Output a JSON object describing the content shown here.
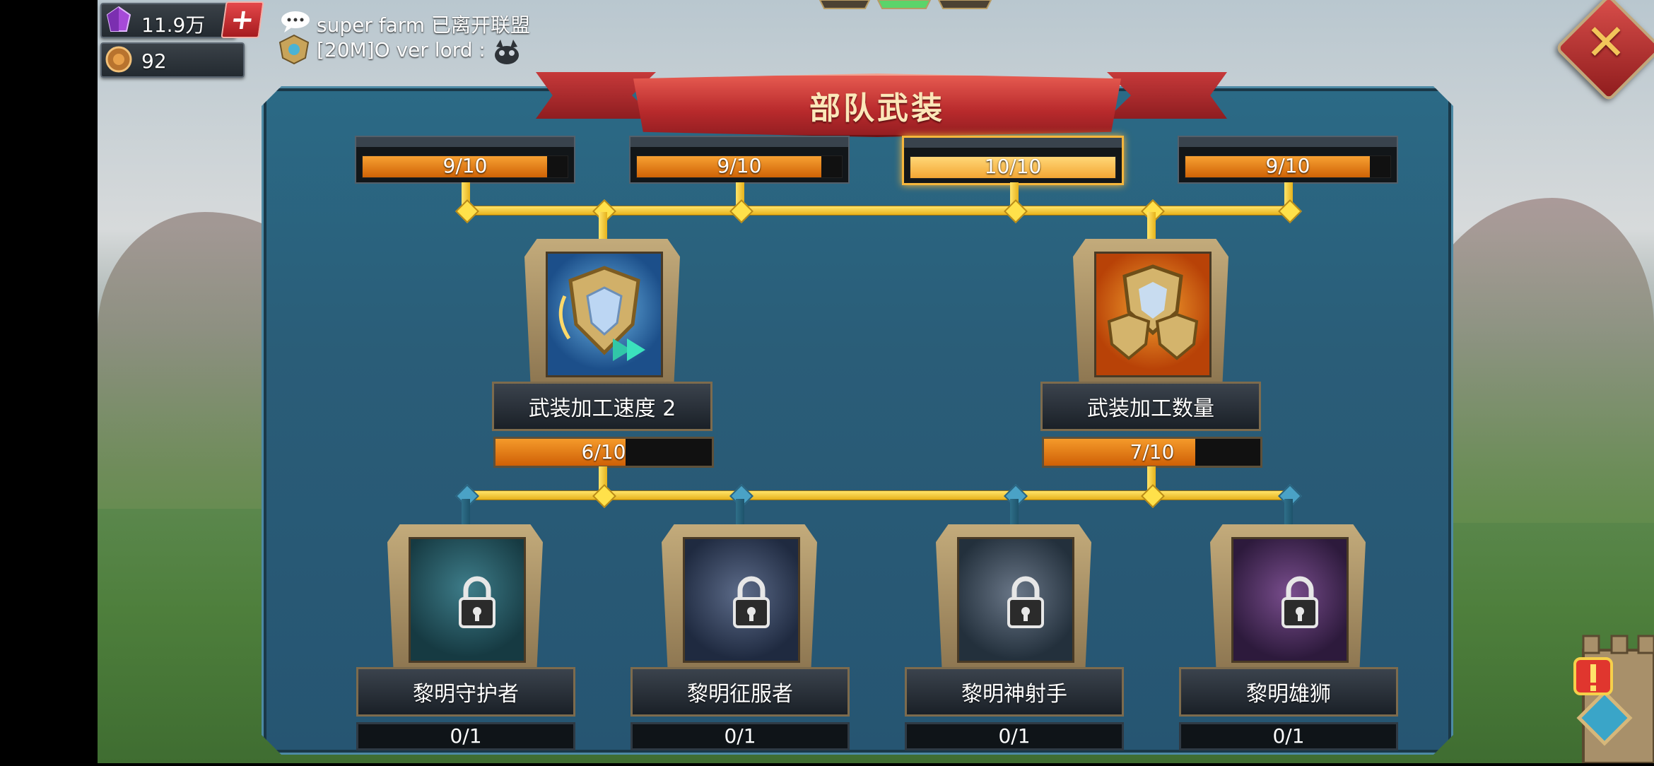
{
  "resources": {
    "gems": "11.9万",
    "coins": "92",
    "plus_label": "+"
  },
  "chat": {
    "line1": "super  farm 已离开联盟",
    "line2": "[20M]O ver lord :"
  },
  "close_label": "✕",
  "title": "部队武装",
  "top_progress": [
    {
      "label": "9/10",
      "value": 9,
      "max": 10
    },
    {
      "label": "9/10",
      "value": 9,
      "max": 10
    },
    {
      "label": "10/10",
      "value": 10,
      "max": 10
    },
    {
      "label": "9/10",
      "value": 9,
      "max": 10
    }
  ],
  "skills": [
    {
      "name": "武装加工速度 2",
      "progress": "6/10",
      "value": 6,
      "max": 10,
      "icon": "shield-speed-icon"
    },
    {
      "name": "武装加工数量",
      "progress": "7/10",
      "value": 7,
      "max": 10,
      "icon": "triple-shield-icon"
    }
  ],
  "units": [
    {
      "name": "黎明守护者",
      "count": "0/1"
    },
    {
      "name": "黎明征服者",
      "count": "0/1"
    },
    {
      "name": "黎明神射手",
      "count": "0/1"
    },
    {
      "name": "黎明雄狮",
      "count": "0/1"
    }
  ],
  "colors": {
    "banner": "#c6393a",
    "panel": "#2b6a86",
    "connector": "#ffe14a",
    "progress_fill": "#f59a2a"
  }
}
